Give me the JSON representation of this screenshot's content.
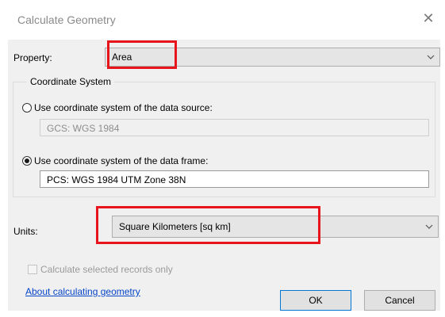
{
  "dialog": {
    "title": "Calculate Geometry",
    "close_glyph": "✕"
  },
  "property": {
    "label": "Property:",
    "value": "Area"
  },
  "coordinate_system": {
    "legend": "Coordinate System",
    "source_option_label": "Use coordinate system of the data source:",
    "source_value": "GCS: WGS 1984",
    "source_selected": false,
    "frame_option_label": "Use coordinate system of the data frame:",
    "frame_value": "PCS: WGS 1984 UTM Zone 38N",
    "frame_selected": true
  },
  "units": {
    "label": "Units:",
    "value": "Square Kilometers [sq km]"
  },
  "selected_only": {
    "label": "Calculate selected records only",
    "checked": false,
    "enabled": false
  },
  "help_link": "About calculating geometry",
  "buttons": {
    "ok": "OK",
    "cancel": "Cancel"
  },
  "colors": {
    "highlight": "#e8141b",
    "link": "#0645c9",
    "dialog_bg": "#f0f0f0"
  }
}
